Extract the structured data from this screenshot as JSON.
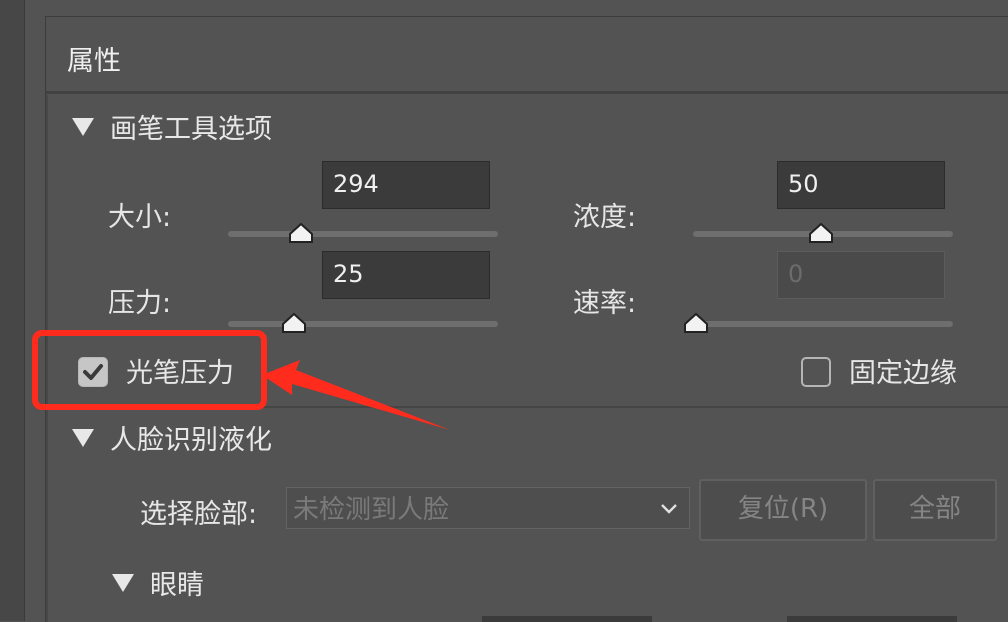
{
  "panel": {
    "title": "属性"
  },
  "brush_section": {
    "title": "画笔工具选项",
    "size": {
      "label": "大小:",
      "value": "294",
      "level_pct": 28
    },
    "density": {
      "label": "浓度:",
      "value": "50",
      "level_pct": 50
    },
    "pressure": {
      "label": "压力:",
      "value": "25",
      "level_pct": 25
    },
    "rate": {
      "label": "速率:",
      "value": "0",
      "level_pct": 0,
      "disabled": true
    },
    "stylus_pressure": {
      "label": "光笔压力",
      "checked": true
    },
    "pin_edges": {
      "label": "固定边缘",
      "checked": false
    }
  },
  "face_section": {
    "title": "人脸识别液化",
    "select_face_label": "选择脸部:",
    "select_face_value": "未检测到人脸",
    "reset_button": "复位(R)",
    "all_button": "全部",
    "eyes_title": "眼睛"
  },
  "icons": {
    "check": "check-icon",
    "chevron": "chevron-down-icon",
    "triangle": "triangle-down-icon"
  },
  "colors": {
    "accent_highlight": "#ff2b1c",
    "panel_bg": "#535353"
  }
}
